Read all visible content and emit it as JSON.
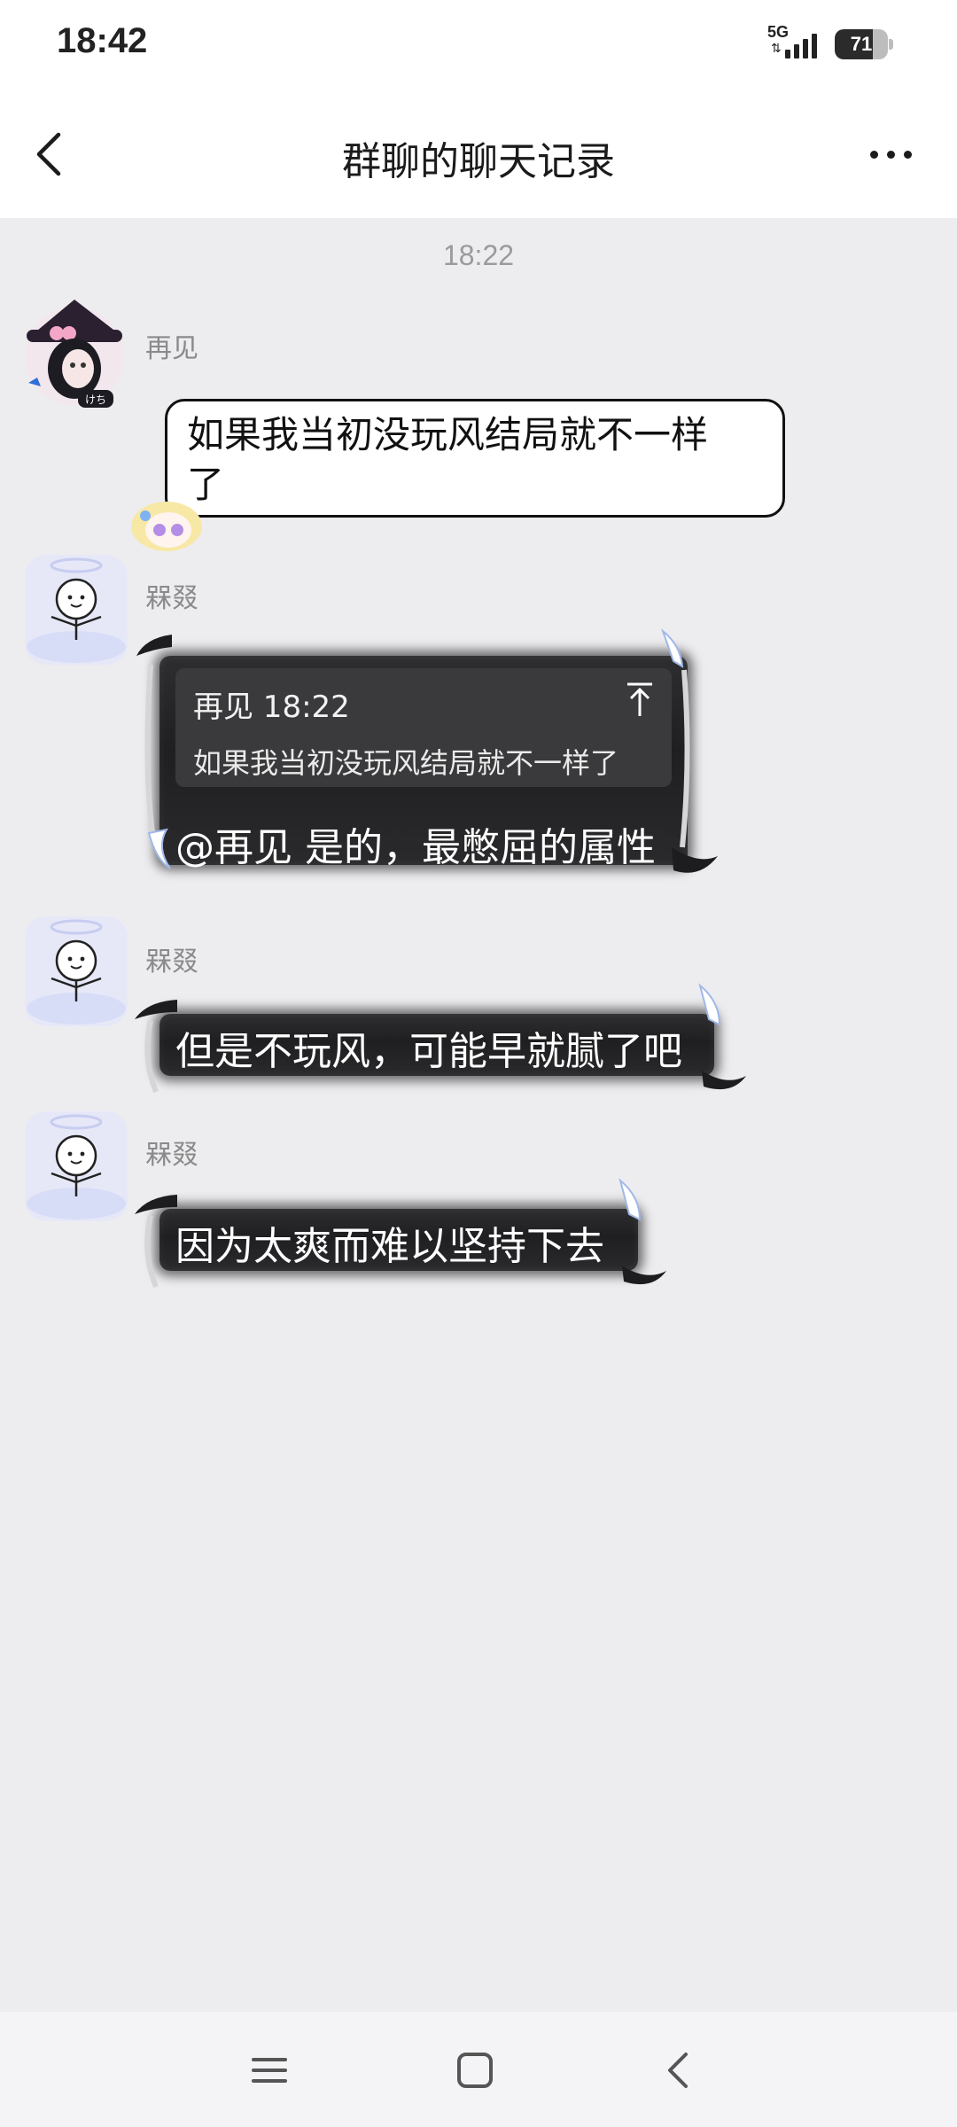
{
  "status_bar": {
    "time": "18:42",
    "network": "5G",
    "battery": 71
  },
  "header": {
    "title": "群聊的聊天记录",
    "back_icon": "chevron-left-icon",
    "more_icon": "more-dots-icon"
  },
  "chat": {
    "timestamp": "18:22",
    "messages": [
      {
        "sender": "再见",
        "text_line1": "如果我当初没玩风结局就不一样",
        "text_line2": "了"
      },
      {
        "sender": "槑叕",
        "quote": {
          "author_time": "再见 18:22",
          "text": "如果我当初没玩风结局就不一样了"
        },
        "text": "@再见 是的，最憋屈的属性"
      },
      {
        "sender": "槑叕",
        "text": "但是不玩风，可能早就腻了吧"
      },
      {
        "sender": "槑叕",
        "text": "因为太爽而难以坚持下去"
      }
    ]
  },
  "nav_bar": {
    "items": [
      "menu-icon",
      "home-square-icon",
      "back-chevron-icon"
    ]
  },
  "colors": {
    "background": "#ededf0",
    "header_bg": "#ffffff",
    "dark_bubble": "#252527",
    "timestamp": "#9a9a9a"
  }
}
